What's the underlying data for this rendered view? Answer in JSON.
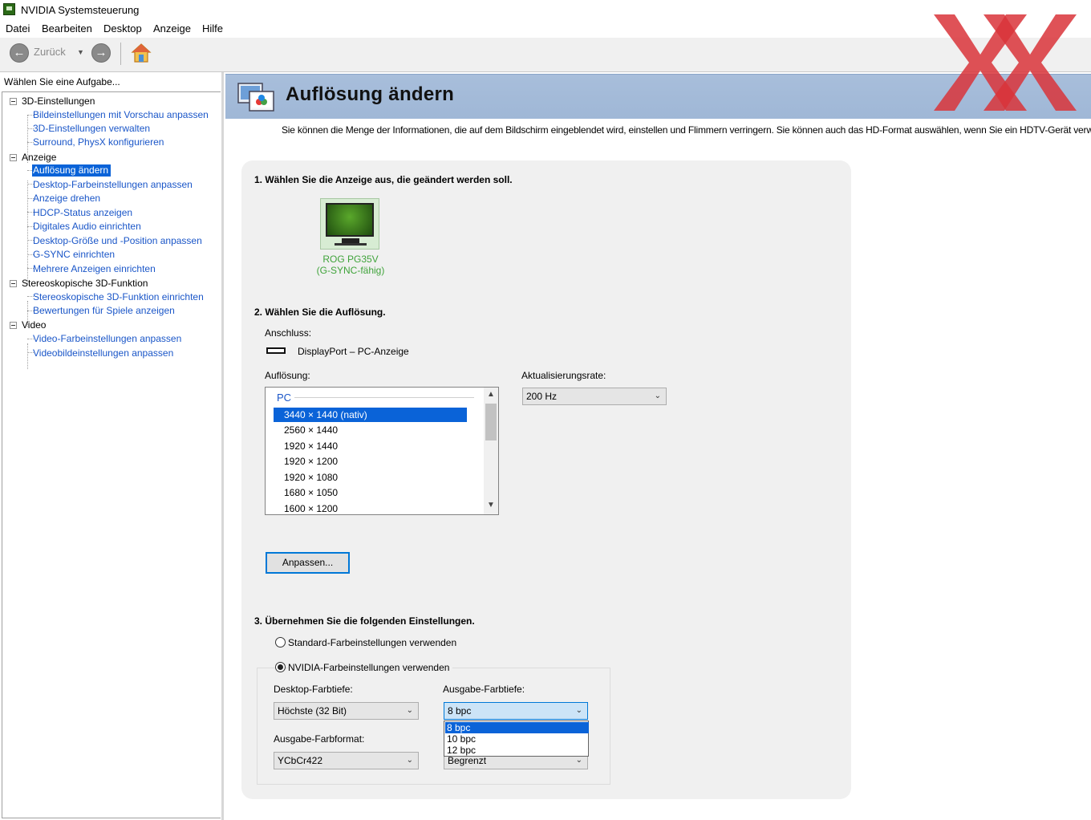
{
  "window": {
    "title": "NVIDIA Systemsteuerung"
  },
  "menu": [
    "Datei",
    "Bearbeiten",
    "Desktop",
    "Anzeige",
    "Hilfe"
  ],
  "toolbar": {
    "back_label": "Zurück"
  },
  "sidebar": {
    "header": "Wählen Sie eine Aufgabe...",
    "groups": [
      {
        "label": "3D-Einstellungen",
        "items": [
          "Bildeinstellungen mit Vorschau anpassen",
          "3D-Einstellungen verwalten",
          "Surround, PhysX konfigurieren"
        ]
      },
      {
        "label": "Anzeige",
        "items": [
          "Auflösung ändern",
          "Desktop-Farbeinstellungen anpassen",
          "Anzeige drehen",
          "HDCP-Status anzeigen",
          "Digitales Audio einrichten",
          "Desktop-Größe und -Position anpassen",
          "G-SYNC einrichten",
          "Mehrere Anzeigen einrichten"
        ]
      },
      {
        "label": "Stereoskopische 3D-Funktion",
        "items": [
          "Stereoskopische 3D-Funktion einrichten",
          "Bewertungen für Spiele anzeigen"
        ]
      },
      {
        "label": "Video",
        "items": [
          "Video-Farbeinstellungen anpassen",
          "Videobildeinstellungen anpassen"
        ]
      }
    ],
    "selected": "Auflösung ändern"
  },
  "page": {
    "title": "Auflösung ändern",
    "description": "Sie können die Menge der Informationen, die auf dem Bildschirm eingeblendet wird, einstellen und Flimmern verringern. Sie können auch das HD-Format auswählen, wenn Sie ein HDTV-Gerät verw",
    "step1": "1. Wählen Sie die Anzeige aus, die geändert werden soll.",
    "monitor": {
      "name": "ROG PG35V",
      "subtitle": "(G-SYNC-fähig)"
    },
    "step2": "2. Wählen Sie die Auflösung.",
    "connection_label": "Anschluss:",
    "connection_value": "DisplayPort – PC-Anzeige",
    "resolution_label": "Auflösung:",
    "resolution_group": "PC",
    "resolutions": [
      "3440 × 1440 (nativ)",
      "2560 × 1440",
      "1920 × 1440",
      "1920 × 1200",
      "1920 × 1080",
      "1680 × 1050",
      "1600 × 1200"
    ],
    "selected_resolution": "3440 × 1440 (nativ)",
    "refresh_label": "Aktualisierungsrate:",
    "refresh_value": "200 Hz",
    "customize_button": "Anpassen...",
    "step3": "3. Übernehmen Sie die folgenden Einstellungen.",
    "radio_default": "Standard-Farbeinstellungen verwenden",
    "radio_nvidia": "NVIDIA-Farbeinstellungen verwenden",
    "desktop_depth_label": "Desktop-Farbtiefe:",
    "desktop_depth_value": "Höchste (32 Bit)",
    "output_depth_label": "Ausgabe-Farbtiefe:",
    "output_depth_value": "8 bpc",
    "output_depth_options": [
      "8 bpc",
      "10 bpc",
      "12 bpc"
    ],
    "output_format_label": "Ausgabe-Farbformat:",
    "output_format_value": "YCbCr422",
    "dynamic_range_value": "Begrenzt"
  },
  "colors": {
    "selection": "#0a63d8",
    "link": "#1a56c8",
    "banner": "#a8bedb",
    "monitor_label": "#3fa33a",
    "watermark": "#d9343a"
  }
}
